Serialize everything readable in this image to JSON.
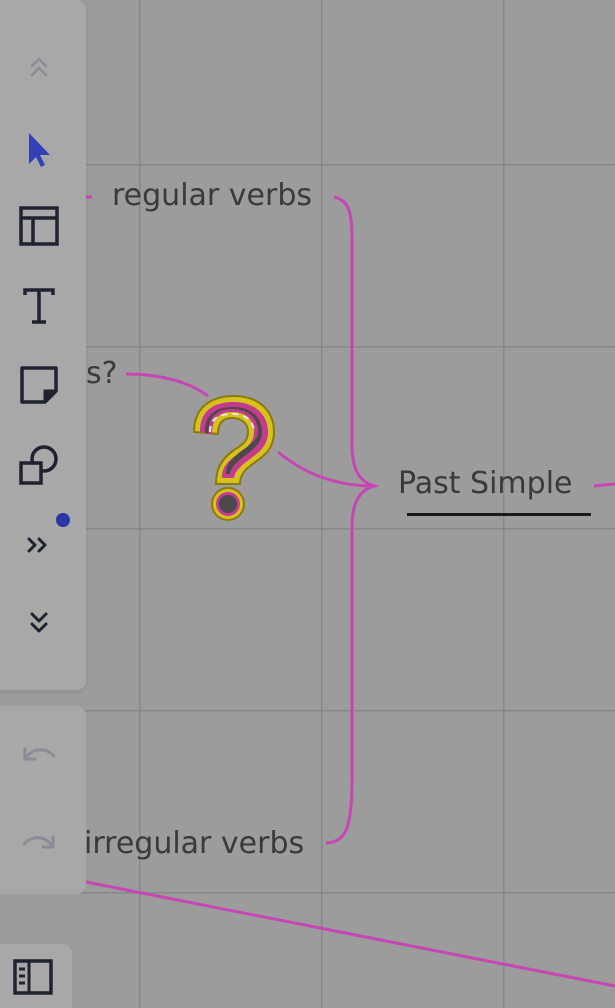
{
  "board": {
    "nodes": {
      "regular_verbs": "regular verbs",
      "questions_fragment": "s?",
      "past_simple": "Past Simple",
      "irregular_verbs": "irregular verbs"
    },
    "connector_color": "#c845b6"
  },
  "toolbar": {
    "tools": [
      {
        "name": "collapse-up-icon"
      },
      {
        "name": "select-cursor-icon",
        "active": true
      },
      {
        "name": "frame-layout-icon"
      },
      {
        "name": "text-tool-icon"
      },
      {
        "name": "sticky-note-icon"
      },
      {
        "name": "shapes-icon"
      },
      {
        "name": "more-tools-icon",
        "notification": true
      },
      {
        "name": "expand-down-icon"
      }
    ],
    "undo": "undo-icon",
    "redo": "redo-icon",
    "panel": "sidebar-panel-icon"
  },
  "colors": {
    "active_tool": "#3340b8",
    "icon": "#1f2330",
    "disabled": "#8a8d96",
    "notification_dot": "#2a35a8"
  }
}
